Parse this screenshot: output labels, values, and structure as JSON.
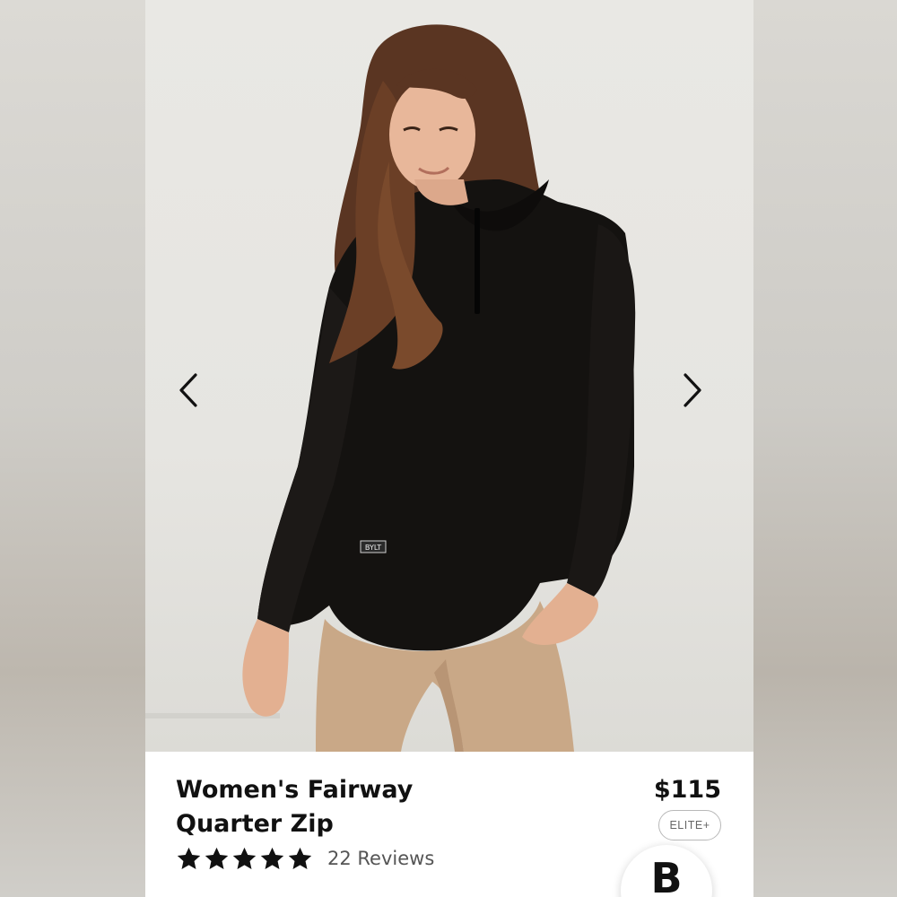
{
  "product": {
    "title_line1": "Women's Fairway",
    "title_line2": "Quarter Zip",
    "price": "$115",
    "tier_badge": "ELITE+",
    "rating": 5,
    "rating_max": 5,
    "reviews_label": "22 Reviews",
    "garment_tag": "BYLT",
    "brand_logo": "B"
  },
  "carousel": {
    "prev_icon": "chevron-left-icon",
    "next_icon": "chevron-right-icon"
  },
  "colors": {
    "star": "#111111",
    "text": "#111111",
    "muted": "#555555",
    "badge_border": "#b8b8b8"
  }
}
